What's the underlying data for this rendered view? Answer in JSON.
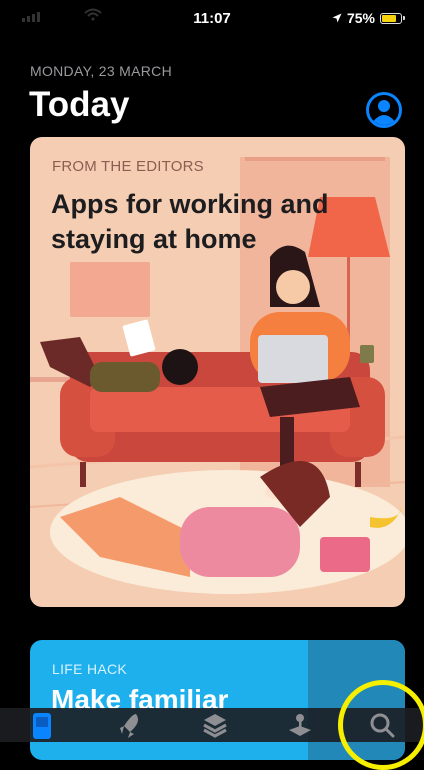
{
  "status_bar": {
    "time": "11:07",
    "battery": "75%"
  },
  "header": {
    "date": "MONDAY, 23 MARCH",
    "title": "Today"
  },
  "cards": [
    {
      "eyebrow": "FROM THE EDITORS",
      "headline": "Apps for working and staying at home"
    },
    {
      "eyebrow": "LIFE HACK",
      "headline": "Make familiar"
    }
  ],
  "tab_bar": {
    "tabs": [
      {
        "icon": "today-icon",
        "active": true
      },
      {
        "icon": "games-rocket-icon",
        "active": false
      },
      {
        "icon": "apps-stack-icon",
        "active": false
      },
      {
        "icon": "arcade-icon",
        "active": false
      },
      {
        "icon": "search-icon",
        "active": false,
        "highlighted": true
      }
    ]
  },
  "colors": {
    "accent": "#0a84ff",
    "highlight_ring": "#f7ef00",
    "battery": "#f7d20f",
    "card1_bg": "#f5cdb3",
    "card2_bg": "#1eb0ec"
  }
}
